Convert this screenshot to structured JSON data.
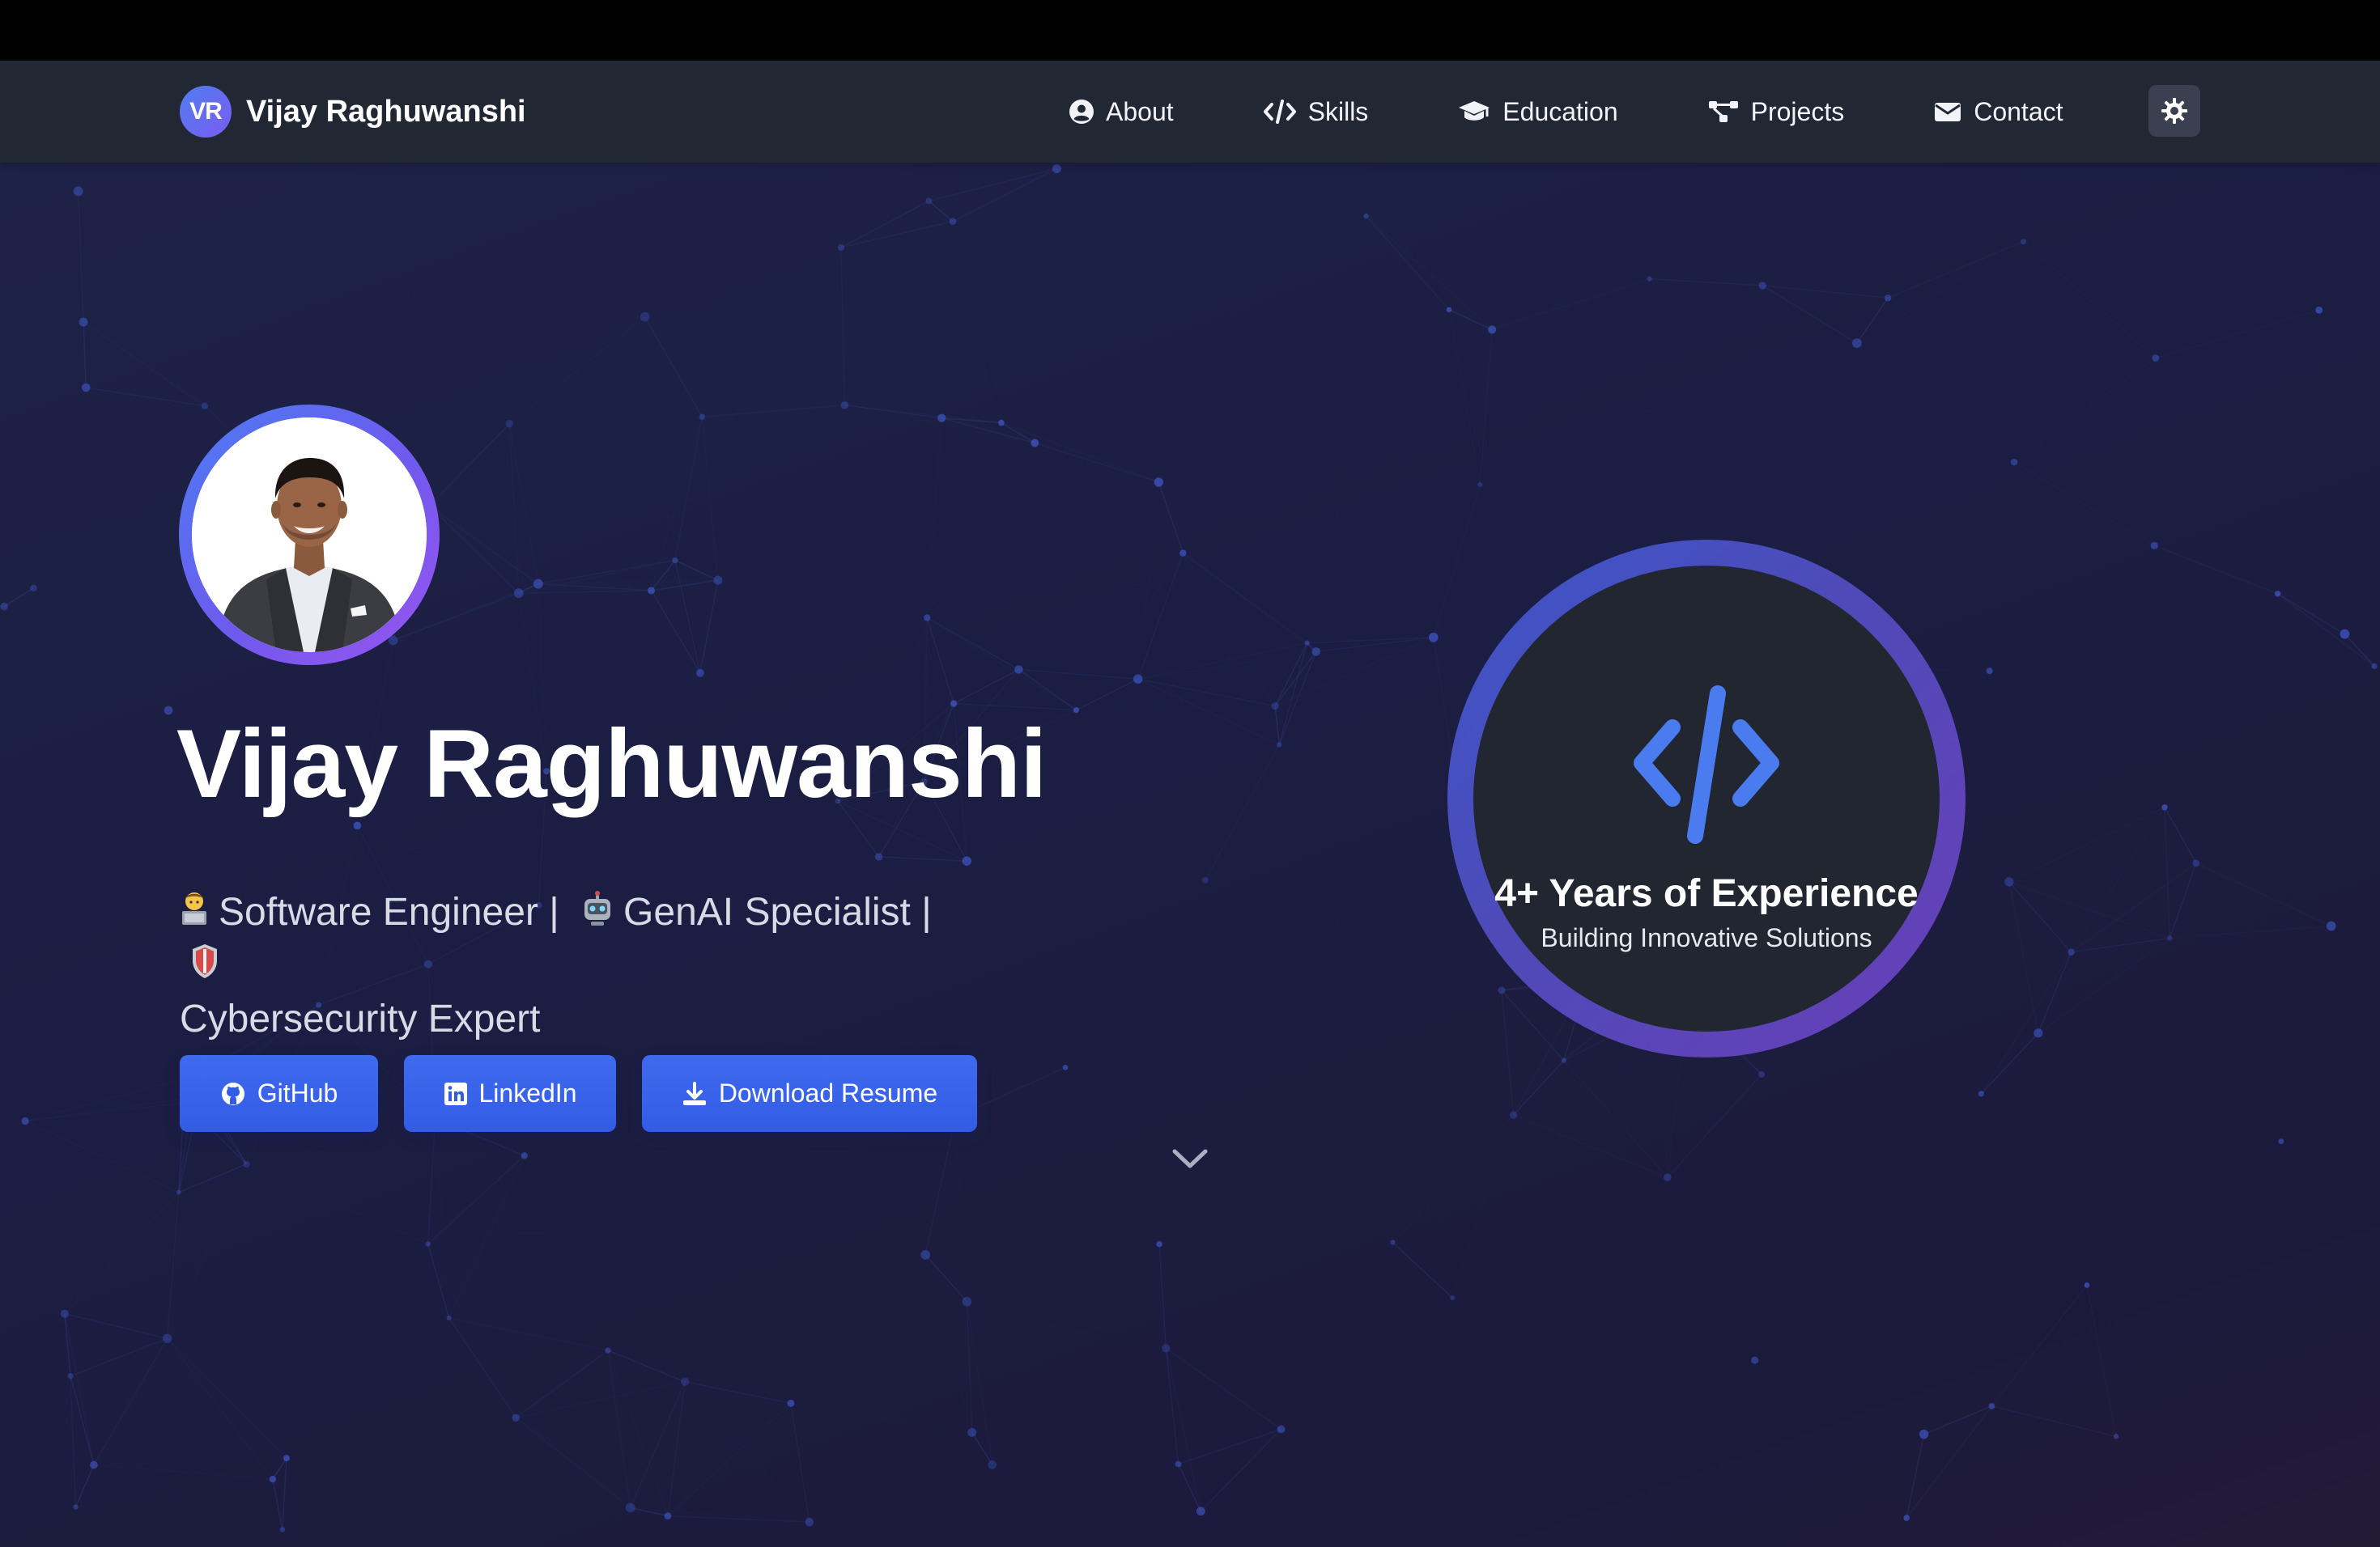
{
  "brand": {
    "logo_text": "VR",
    "name": "Vijay Raghuwanshi"
  },
  "nav": {
    "items": [
      {
        "label": "About",
        "icon": "user-circle-icon"
      },
      {
        "label": "Skills",
        "icon": "code-icon"
      },
      {
        "label": "Education",
        "icon": "graduation-cap-icon"
      },
      {
        "label": "Projects",
        "icon": "project-diagram-icon"
      },
      {
        "label": "Contact",
        "icon": "envelope-icon"
      }
    ],
    "theme_toggle_icon": "sun-gear-icon"
  },
  "hero": {
    "name": "Vijay Raghuwanshi",
    "roles": [
      {
        "emoji": "👨‍💻",
        "text": "Software Engineer |"
      },
      {
        "emoji": "🤖",
        "text": "GenAI Specialist |"
      },
      {
        "emoji": "🛡️",
        "text": "Cybersecurity Expert"
      }
    ],
    "buttons": [
      {
        "label": "GitHub",
        "icon": "github-icon"
      },
      {
        "label": "LinkedIn",
        "icon": "linkedin-icon"
      },
      {
        "label": "Download Resume",
        "icon": "download-icon"
      }
    ],
    "scroll_icon": "chevron-down-icon"
  },
  "experience": {
    "icon": "code-icon",
    "title": "4+ Years of Experience",
    "subtitle": "Building Innovative Solutions"
  },
  "colors": {
    "accent": "#3f6aee",
    "navbar": "#222734",
    "background": "#1e2246",
    "ring_gradient": [
      "#3c56c9",
      "#6a3fb8"
    ]
  }
}
